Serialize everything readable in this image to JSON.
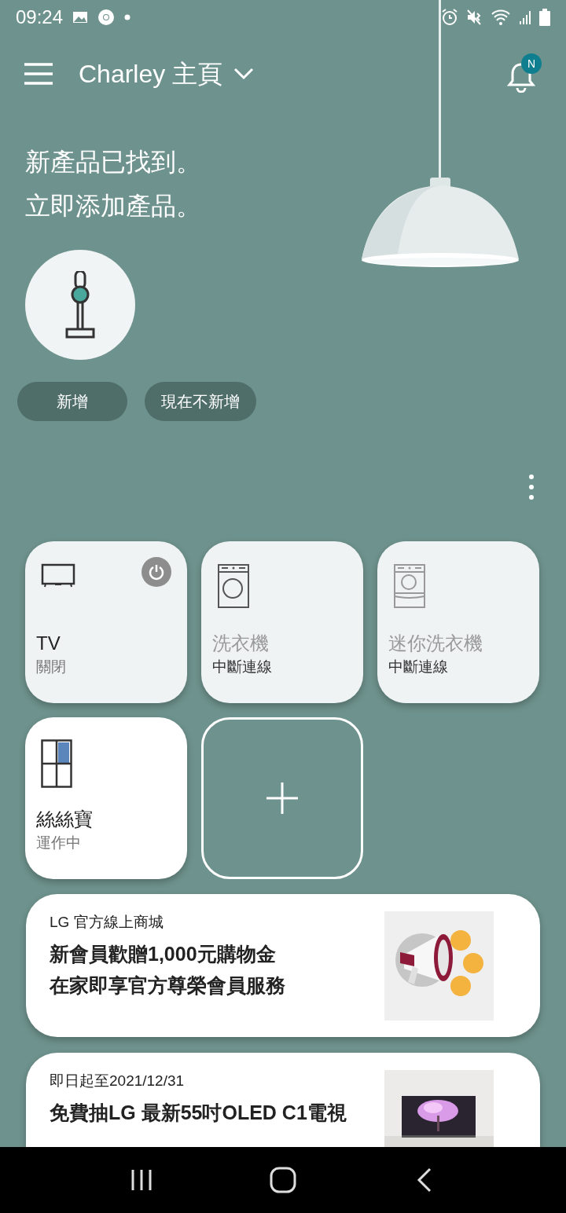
{
  "status_bar": {
    "time": "09:24"
  },
  "header": {
    "title": "Charley 主頁",
    "notification_badge": "N"
  },
  "discovery": {
    "lines": [
      "新產品已找到。",
      "立即添加產品。"
    ],
    "buttons": [
      "新增",
      "現在不新增"
    ]
  },
  "devices": [
    {
      "kind": "tv",
      "name": "TV",
      "status": "關閉",
      "connected": true,
      "on": false
    },
    {
      "kind": "washer",
      "name": "洗衣機",
      "status": "中斷連線",
      "connected": false,
      "on": false
    },
    {
      "kind": "mini_washer",
      "name": "迷你洗衣機",
      "status": "中斷連線",
      "connected": false,
      "on": false
    },
    {
      "kind": "fridge",
      "name": "絲絲寶",
      "status": "運作中",
      "connected": true,
      "on": true
    }
  ],
  "promos": [
    {
      "kicker": "LG 官方線上商城",
      "lines": [
        "新會員歡贈1,000元購物金",
        "在家即享官方尊榮會員服務"
      ],
      "kind": "picture"
    },
    {
      "kicker": "即日起至2021/12/31",
      "lines": [
        "免費抽LG 最新55吋OLED C1電視"
      ],
      "kind": "picture"
    }
  ]
}
